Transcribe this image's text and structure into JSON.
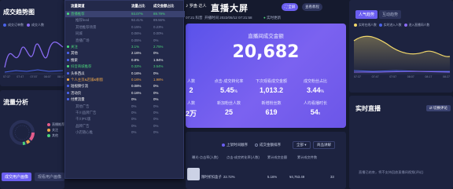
{
  "left": {
    "title": "成交趋势图",
    "legend": [
      "成交订单数",
      "成交人数"
    ],
    "xticks": [
      "07:37",
      "07:47",
      "07:57",
      "08:07",
      "08:17",
      "08:27"
    ]
  },
  "flow": {
    "title": "流量分析",
    "legend": [
      "直播推荐",
      "关注",
      "其他"
    ],
    "tab_active": "成交用户画像",
    "tab_other": "观看用户画像"
  },
  "overlay": {
    "headers": [
      "流量渠道",
      "流量占比",
      "成交金额占比"
    ],
    "rows": [
      {
        "name": "直播推荐",
        "share": "93.07%",
        "gmv": "89.79%",
        "style": "sel"
      },
      {
        "name": "推荐feed",
        "share": "92.41%",
        "gmv": "89.56%",
        "style": "muted"
      },
      {
        "name": "其他推荐场景",
        "share": "0.15%",
        "gmv": "0.23%",
        "style": "muted"
      },
      {
        "name": "同城",
        "share": "0.06%",
        "gmv": "0.00%",
        "style": "muted"
      },
      {
        "name": "直播广场",
        "share": "0.05%",
        "gmv": "0%",
        "style": "muted"
      },
      {
        "name": "关注",
        "share": "3.1%",
        "gmv": "2.75%",
        "style": "green"
      },
      {
        "name": "其他",
        "share": "2.16%",
        "gmv": "0%",
        "style": "white"
      },
      {
        "name": "搜索",
        "share": "0.8%",
        "gmv": "1.94%",
        "style": "white"
      },
      {
        "name": "抖音商城推荐",
        "share": "0.32%",
        "gmv": "3.54%",
        "style": "green"
      },
      {
        "name": "头条西瓜",
        "share": "0.16%",
        "gmv": "0%",
        "style": "white"
      },
      {
        "name": "个人主页&店铺&橱窗",
        "share": "0.16%",
        "gmv": "1.98%",
        "style": "orange"
      },
      {
        "name": "短视频引流",
        "share": "0.08%",
        "gmv": "0%",
        "style": "white"
      },
      {
        "name": "活动页",
        "share": "0.16%",
        "gmv": "0%",
        "style": "white"
      },
      {
        "name": "付费流量",
        "share": "0%",
        "gmv": "0%",
        "style": "white"
      },
      {
        "name": "其他广告",
        "share": "0%",
        "gmv": "0%",
        "style": "muted"
      },
      {
        "name": "千川品牌广告",
        "share": "0%",
        "gmv": "0%",
        "style": "muted"
      },
      {
        "name": "千川PC版",
        "share": "0%",
        "gmv": "0%",
        "style": "muted"
      },
      {
        "name": "品牌广告",
        "share": "0%",
        "gmv": "0%",
        "style": "muted"
      },
      {
        "name": "小店随心推",
        "share": "0%",
        "gmv": "0%",
        "style": "muted"
      }
    ]
  },
  "header": {
    "brand": "罗盘·达人",
    "title": "直播大屏",
    "btn_full": "全屏",
    "btn_tutorial": "查看教程",
    "open_time": "开播时间 2022/05/12 07:21:58",
    "flag": "实时更新",
    "sub_left": "07:21 科普"
  },
  "gmv": {
    "label": "直播间成交金额",
    "value": "20,682",
    "kpis_row1": [
      {
        "label": "人数",
        "value": "2"
      },
      {
        "label": "点击-成交转化率",
        "value": "5.45",
        "unit": "%"
      },
      {
        "label": "下次观看成交金额",
        "value": "1,013.2"
      },
      {
        "label": "成交粉丝占比",
        "value": "3.44",
        "unit": "%"
      }
    ],
    "kpis_row2": [
      {
        "label": "人数",
        "value": "2万"
      },
      {
        "label": "新加粉丝人数",
        "value": "25"
      },
      {
        "label": "新增粉丝数",
        "value": "619"
      },
      {
        "label": "人均看播时长",
        "value": "54",
        "unit": "s"
      }
    ]
  },
  "bottom": {
    "radio1": "上架时间顺序",
    "radio2": "成交金额排序",
    "btn1": "全部",
    "btn2": "商品讲解",
    "headers": [
      "商品",
      "曝光-点击率(人数)",
      "点击-成交转化率(人数)",
      "累计成交金额",
      "累计成交件数"
    ],
    "row": [
      "限时折扣盒子",
      "22.72%",
      "5.16%",
      "¥4,753.49",
      "33"
    ]
  },
  "right": {
    "tab_active": "人气趋势",
    "tab_other": "互动趋势",
    "legend": [
      "实时在线人数",
      "实时进入人数",
      "进入直播间人数"
    ],
    "xticks": [
      "07:37",
      "07:47",
      "07:57",
      "08:07",
      "08:17",
      "08:27"
    ]
  },
  "live": {
    "title": "实时直播",
    "btn": "切换评论",
    "note": "直播已结束，将不支持回放直播间视频(评论)"
  },
  "colors": {
    "accent": "#6a5ef0",
    "purple_line": "#8a6cf4",
    "yellow_line": "#f2d86b",
    "blue_line": "#4a63e8"
  }
}
